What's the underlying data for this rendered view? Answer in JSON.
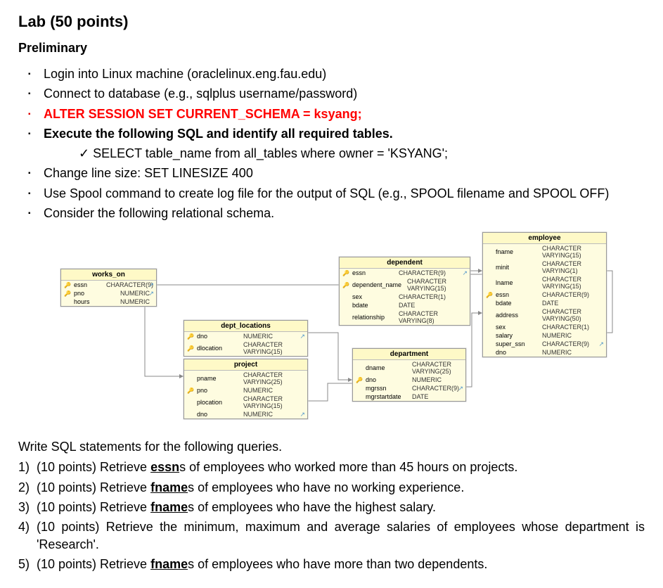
{
  "title": "Lab (50 points)",
  "section_prelim": "Preliminary",
  "prelim": {
    "login": "Login into Linux machine (oraclelinux.eng.fau.edu)",
    "connect": "Connect to database (e.g., sqlplus username/password)",
    "alter": "ALTER SESSION SET CURRENT_SCHEMA = ksyang;",
    "execute": "Execute the following SQL and identify all required tables.",
    "select": "SELECT table_name from all_tables where owner = 'KSYANG';",
    "linesize": "Change line size: SET LINESIZE 400",
    "spool": "Use Spool command to create log file for the output of SQL (e.g., SPOOL filename and SPOOL OFF)",
    "consider": "Consider the following relational schema."
  },
  "schema": {
    "works_on": {
      "title": "works_on",
      "cols": [
        {
          "k": "🔑",
          "n": "essn",
          "t": "CHARACTER(9)"
        },
        {
          "k": "🔑",
          "n": "pno",
          "t": "NUMERIC"
        },
        {
          "k": "",
          "n": "hours",
          "t": "NUMERIC"
        }
      ]
    },
    "dept_locations": {
      "title": "dept_locations",
      "cols": [
        {
          "k": "🔑",
          "n": "dno",
          "t": "NUMERIC"
        },
        {
          "k": "🔑",
          "n": "dlocation",
          "t": "CHARACTER VARYING(15)"
        }
      ]
    },
    "project": {
      "title": "project",
      "cols": [
        {
          "k": "",
          "n": "pname",
          "t": "CHARACTER VARYING(25)"
        },
        {
          "k": "🔑",
          "n": "pno",
          "t": "NUMERIC"
        },
        {
          "k": "",
          "n": "plocation",
          "t": "CHARACTER VARYING(15)"
        },
        {
          "k": "",
          "n": "dno",
          "t": "NUMERIC"
        }
      ]
    },
    "dependent": {
      "title": "dependent",
      "cols": [
        {
          "k": "🔑",
          "n": "essn",
          "t": "CHARACTER(9)"
        },
        {
          "k": "🔑",
          "n": "dependent_name",
          "t": "CHARACTER VARYING(15)"
        },
        {
          "k": "",
          "n": "sex",
          "t": "CHARACTER(1)"
        },
        {
          "k": "",
          "n": "bdate",
          "t": "DATE"
        },
        {
          "k": "",
          "n": "relationship",
          "t": "CHARACTER VARYING(8)"
        }
      ]
    },
    "department": {
      "title": "department",
      "cols": [
        {
          "k": "",
          "n": "dname",
          "t": "CHARACTER VARYING(25)"
        },
        {
          "k": "🔑",
          "n": "dno",
          "t": "NUMERIC"
        },
        {
          "k": "",
          "n": "mgrssn",
          "t": "CHARACTER(9)"
        },
        {
          "k": "",
          "n": "mgrstartdate",
          "t": "DATE"
        }
      ]
    },
    "employee": {
      "title": "employee",
      "cols": [
        {
          "k": "",
          "n": "fname",
          "t": "CHARACTER VARYING(15)"
        },
        {
          "k": "",
          "n": "minit",
          "t": "CHARACTER VARYING(1)"
        },
        {
          "k": "",
          "n": "lname",
          "t": "CHARACTER VARYING(15)"
        },
        {
          "k": "🔑",
          "n": "essn",
          "t": "CHARACTER(9)"
        },
        {
          "k": "",
          "n": "bdate",
          "t": "DATE"
        },
        {
          "k": "",
          "n": "address",
          "t": "CHARACTER VARYING(50)"
        },
        {
          "k": "",
          "n": "sex",
          "t": "CHARACTER(1)"
        },
        {
          "k": "",
          "n": "salary",
          "t": "NUMERIC"
        },
        {
          "k": "",
          "n": "super_ssn",
          "t": "CHARACTER(9)"
        },
        {
          "k": "",
          "n": "dno",
          "t": "NUMERIC"
        }
      ]
    }
  },
  "intro_q": "Write SQL statements for the following queries.",
  "questions": {
    "q1_num": "1)",
    "q1_pts": "(10 points) Retrieve ",
    "q1_bold": "essn",
    "q1_rest": "s of employees who worked more than 45 hours on projects.",
    "q2_num": "2)",
    "q2_pts": "(10 points) Retrieve ",
    "q2_bold": "fname",
    "q2_rest": "s of employees who have no working experience.",
    "q3_num": "3)",
    "q3_pts": "(10 points) Retrieve ",
    "q3_bold": "fname",
    "q3_rest": "s of employees who have the highest salary.",
    "q4_num": "4)",
    "q4_txt": "(10 points) Retrieve the minimum, maximum and average salaries of employees whose department is 'Research'.",
    "q5_num": "5)",
    "q5_pts": " (10 points) Retrieve ",
    "q5_bold": "fname",
    "q5_rest": "s of employees who have more than two dependents."
  }
}
